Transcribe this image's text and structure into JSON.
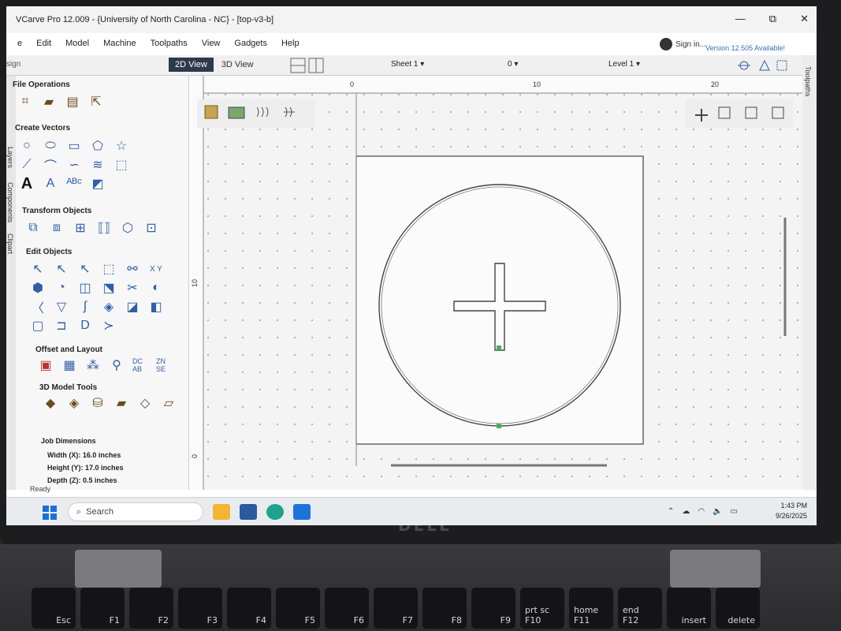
{
  "window": {
    "title": "VCarve Pro 12.009 - {University of North Carolina - NC} - [top-v3-b]",
    "minimize": "—",
    "maximize": "⧉",
    "close": "✕"
  },
  "menu": [
    "e",
    "Edit",
    "Model",
    "Machine",
    "Toolpaths",
    "View",
    "Gadgets",
    "Help"
  ],
  "account": {
    "sign_in": "Sign in...",
    "version_notice": "Version 12.505 Available!"
  },
  "toolbar": {
    "panel_title": "sign",
    "tab_2d": "2D View",
    "tab_3d": "3D View",
    "sheet": "Sheet 1 ▾",
    "sheet_index": "0 ▾",
    "level": "Level 1 ▾"
  },
  "left_panel": {
    "sections": {
      "file_operations": "File Operations",
      "create_vectors": "Create Vectors",
      "transform_objects": "Transform Objects",
      "edit_objects": "Edit Objects",
      "offset_layout": "Offset and Layout",
      "model_tools": "3D Model Tools"
    },
    "side_tabs": [
      "Layers",
      "Components",
      "Clipart"
    ],
    "job": {
      "heading": "Job Dimensions",
      "width": "Width  (X): 16.0 inches",
      "height": "Height (Y): 17.0 inches",
      "depth": "Depth  (Z): 0.5 inches"
    }
  },
  "right_strip": {
    "label": "Toolpaths"
  },
  "ruler": {
    "top_labels": [
      "0",
      "10",
      "20"
    ],
    "left_labels": [
      "10",
      "0"
    ]
  },
  "status": "Ready",
  "taskbar": {
    "search": "Search",
    "time": "1:43 PM",
    "date": "9/26/2025"
  },
  "keyboard": [
    "Esc",
    "F1",
    "F2",
    "F3",
    "F4",
    "F5",
    "F6",
    "F7",
    "F8",
    "F9",
    "prt sc F10",
    "home F11",
    "end F12",
    "insert",
    "delete"
  ],
  "laptop_brand": "DELL"
}
